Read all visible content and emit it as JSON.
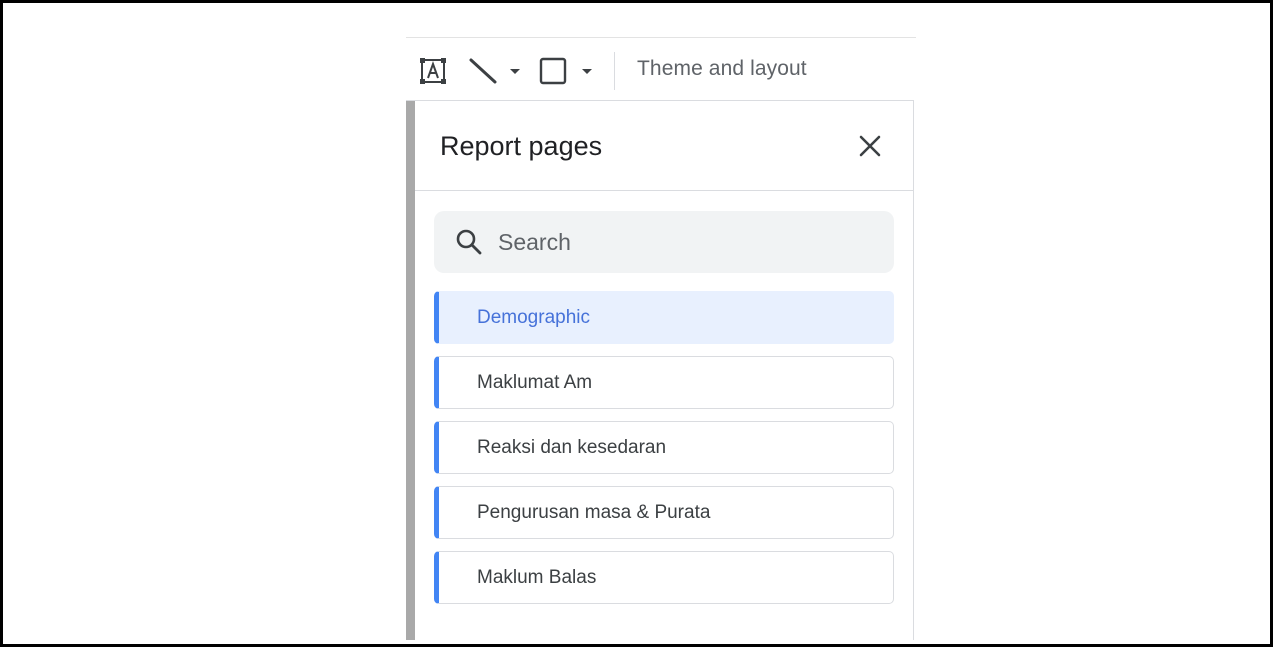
{
  "toolbar": {
    "theme_label": "Theme and layout",
    "icons": [
      "text-box-icon",
      "line-icon",
      "line-dropdown-caret-icon",
      "shape-icon",
      "shape-dropdown-caret-icon"
    ]
  },
  "panel": {
    "title": "Report pages",
    "close_icon": "close-icon"
  },
  "search": {
    "placeholder": "Search",
    "value": "",
    "icon": "search-icon"
  },
  "pages": [
    {
      "label": "Demographic",
      "active": true
    },
    {
      "label": "Maklumat Am",
      "active": false
    },
    {
      "label": "Reaksi dan kesedaran",
      "active": false
    },
    {
      "label": "Pengurusan masa & Purata",
      "active": false
    },
    {
      "label": "Maklum Balas",
      "active": false
    }
  ],
  "colors": {
    "accent": "#4285f4",
    "active_bg": "#e8f0fe",
    "active_text": "#4672d9",
    "text": "#3c4043"
  }
}
